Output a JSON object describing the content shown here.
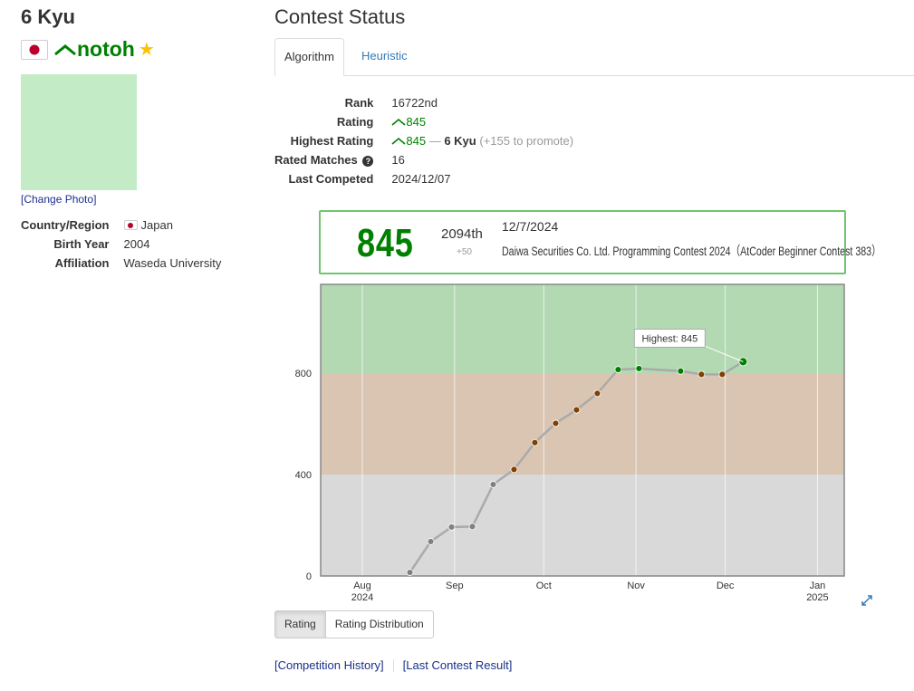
{
  "profile": {
    "kyu_title": "6 Kyu",
    "user_name": "notoh",
    "user_color": "#008000",
    "star_glyph": "★",
    "change_photo_label": "[Change Photo]",
    "info": [
      {
        "label": "Country/Region",
        "value": "Japan"
      },
      {
        "label": "Birth Year",
        "value": "2004"
      },
      {
        "label": "Affiliation",
        "value": "Waseda University"
      }
    ]
  },
  "contest_status": {
    "title": "Contest Status",
    "tabs": [
      {
        "label": "Algorithm",
        "active": true
      },
      {
        "label": "Heuristic",
        "active": false
      }
    ],
    "rows": {
      "rank_label": "Rank",
      "rank_value": "16722nd",
      "rating_label": "Rating",
      "rating_value": "845",
      "highest_label": "Highest Rating",
      "highest_value": "845",
      "highest_sep": "—",
      "highest_kyu": "6 Kyu",
      "highest_promote": "(+155 to promote)",
      "matches_label": "Rated Matches",
      "matches_value": "16",
      "last_label": "Last Competed",
      "last_value": "2024/12/07"
    }
  },
  "contest_box": {
    "rating": "845",
    "rank": "2094th",
    "diff": "+50",
    "date": "12/7/2024",
    "name": "Daiwa Securities Co. Ltd. Programming Contest 2024（AtCoder Beginner Contest 383）"
  },
  "chart_data": {
    "type": "line",
    "x_tick_labels": [
      {
        "month": "Aug",
        "year": "2024"
      },
      {
        "month": "Sep",
        "year": ""
      },
      {
        "month": "Oct",
        "year": ""
      },
      {
        "month": "Nov",
        "year": ""
      },
      {
        "month": "Dec",
        "year": ""
      },
      {
        "month": "Jan",
        "year": "2025"
      }
    ],
    "y_ticks": [
      0,
      400,
      800
    ],
    "ylim": [
      0,
      1150
    ],
    "xlim": [
      "2024-07-18",
      "2025-01-10"
    ],
    "bands": [
      {
        "from": 0,
        "to": 400,
        "color": "#d9d9d9"
      },
      {
        "from": 400,
        "to": 800,
        "color": "#d9c5b2"
      },
      {
        "from": 800,
        "to": 1150,
        "color": "#b2d9b2"
      }
    ],
    "series": [
      {
        "points": [
          {
            "date": "2024-08-17",
            "rating": 14
          },
          {
            "date": "2024-08-24",
            "rating": 136
          },
          {
            "date": "2024-08-31",
            "rating": 193
          },
          {
            "date": "2024-09-07",
            "rating": 195
          },
          {
            "date": "2024-09-14",
            "rating": 361
          },
          {
            "date": "2024-09-21",
            "rating": 420
          },
          {
            "date": "2024-09-28",
            "rating": 526
          },
          {
            "date": "2024-10-05",
            "rating": 602
          },
          {
            "date": "2024-10-12",
            "rating": 655
          },
          {
            "date": "2024-10-19",
            "rating": 720
          },
          {
            "date": "2024-10-26",
            "rating": 814
          },
          {
            "date": "2024-11-02",
            "rating": 818
          },
          {
            "date": "2024-11-16",
            "rating": 808
          },
          {
            "date": "2024-11-23",
            "rating": 795
          },
          {
            "date": "2024-11-30",
            "rating": 795
          },
          {
            "date": "2024-12-07",
            "rating": 845
          }
        ]
      }
    ],
    "annotation": "Highest: 845",
    "point_colors": {
      "gray": "#808080",
      "brown": "#804000",
      "green": "#008000"
    }
  },
  "graph_buttons": [
    {
      "label": "Rating",
      "active": true
    },
    {
      "label": "Rating Distribution",
      "active": false
    }
  ],
  "links": {
    "history": "[Competition History]",
    "last_result": "[Last Contest Result]"
  }
}
